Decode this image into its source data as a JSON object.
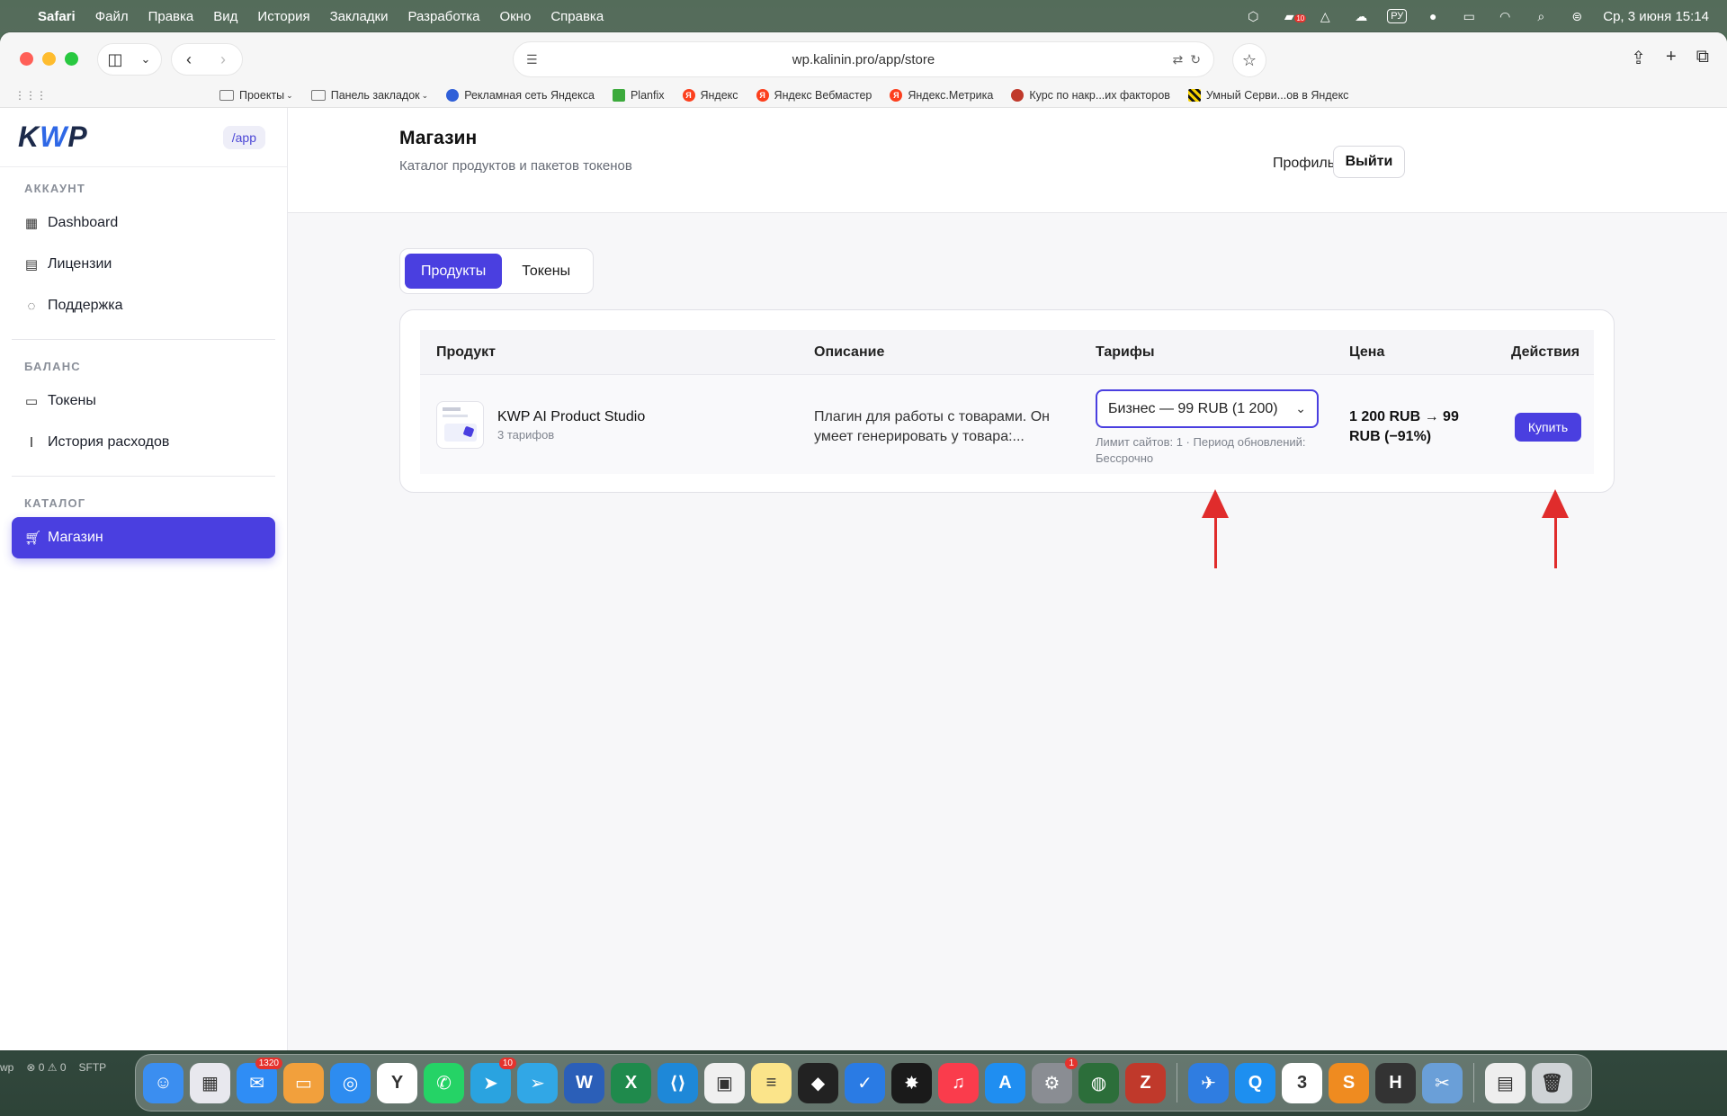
{
  "menubar": {
    "app_name": "Safari",
    "items": [
      "Файл",
      "Правка",
      "Вид",
      "История",
      "Закладки",
      "Разработка",
      "Окно",
      "Справка"
    ],
    "badge": "10",
    "lang": "РУ",
    "datetime": "Ср, 3 июня  15:14"
  },
  "browser": {
    "url": "wp.kalinin.pro/app/store",
    "bookmarks": [
      {
        "label": "Проекты",
        "icon": "folder-icon",
        "dropdown": true
      },
      {
        "label": "Панель закладок",
        "icon": "folder-icon",
        "dropdown": true
      },
      {
        "label": "Рекламная сеть Яндекса",
        "icon": "globe-icon",
        "color": "#f5c518"
      },
      {
        "label": "Planfix",
        "icon": "flag-icon",
        "color": "#3caa3c"
      },
      {
        "label": "Яндекс",
        "icon": "yandex-icon",
        "color": "#fc3f1d"
      },
      {
        "label": "Яндекс Вебмастер",
        "icon": "yandex-icon",
        "color": "#fc3f1d"
      },
      {
        "label": "Яндекс.Метрика",
        "icon": "yandex-icon",
        "color": "#fc3f1d"
      },
      {
        "label": "Курс по накр...их факторов",
        "icon": "seo-icon",
        "color": "#c0392b"
      },
      {
        "label": "Умный Серви...ов в Яндекс",
        "icon": "stripe-icon",
        "color": "#f5d000"
      }
    ]
  },
  "sidebar": {
    "logo": {
      "k": "K",
      "w": "W",
      "p": "P"
    },
    "app_chip": "/app",
    "sections": [
      {
        "title": "АККАУНТ",
        "items": [
          {
            "label": "Dashboard",
            "icon": "grid-icon"
          },
          {
            "label": "Лицензии",
            "icon": "license-icon"
          },
          {
            "label": "Поддержка",
            "icon": "chat-icon"
          }
        ]
      },
      {
        "title": "БАЛАНС",
        "items": [
          {
            "label": "Токены",
            "icon": "card-icon"
          },
          {
            "label": "История расходов",
            "icon": "history-icon"
          }
        ]
      },
      {
        "title": "КАТАЛОГ",
        "items": [
          {
            "label": "Магазин",
            "icon": "cart-icon",
            "active": true
          }
        ]
      }
    ]
  },
  "header": {
    "title": "Магазин",
    "subtitle": "Каталог продуктов и пакетов токенов",
    "profile": "Профиль",
    "logout": "Выйти"
  },
  "tabs": [
    {
      "label": "Продукты",
      "active": true
    },
    {
      "label": "Токены",
      "active": false
    }
  ],
  "table": {
    "columns": [
      "Продукт",
      "Описание",
      "Тарифы",
      "Цена",
      "Действия"
    ],
    "rows": [
      {
        "product_name": "KWP AI Product Studio",
        "product_sub": "3 тарифов",
        "description": "Плагин для работы с товарами. Он умеет генерировать у товара:...",
        "tariff_selected": "Бизнес — 99 RUB (1 200)",
        "tariff_note": "Лимит сайтов: 1 · Период обновлений: Бессрочно",
        "price": "1 200 RUB → 99 RUB (−91%)",
        "action": "Купить"
      }
    ]
  },
  "dock": {
    "status": [
      "wp",
      "⊗ 0 ⚠ 0",
      "SFTP"
    ],
    "apps": [
      {
        "name": "finder-icon",
        "color": "#3b8ef0",
        "glyph": "☺"
      },
      {
        "name": "launchpad-icon",
        "color": "#e8e8ee",
        "glyph": "▦"
      },
      {
        "name": "mail-icon",
        "color": "#2f8df5",
        "glyph": "✉",
        "badge": "1320"
      },
      {
        "name": "inbox-icon",
        "color": "#f2a03c",
        "glyph": "▭"
      },
      {
        "name": "safari-icon",
        "color": "#2d8cf0",
        "glyph": "◎"
      },
      {
        "name": "yandex-browser-icon",
        "color": "#ffffff",
        "glyph": "Y"
      },
      {
        "name": "whatsapp-icon",
        "color": "#25d366",
        "glyph": "✆"
      },
      {
        "name": "telegram-icon",
        "color": "#2aa3e0",
        "glyph": "➤",
        "badge": "10"
      },
      {
        "name": "telegram-x-icon",
        "color": "#31a7e6",
        "glyph": "➢"
      },
      {
        "name": "word-icon",
        "color": "#2b5fb8",
        "glyph": "W"
      },
      {
        "name": "excel-icon",
        "color": "#1f8a4c",
        "glyph": "X"
      },
      {
        "name": "vscode-icon",
        "color": "#1e88d8",
        "glyph": "⟨⟩"
      },
      {
        "name": "terminal-icon",
        "color": "#f0f0f0",
        "glyph": "▣"
      },
      {
        "name": "notes-icon",
        "color": "#fbe48a",
        "glyph": "≡"
      },
      {
        "name": "cube-app-icon",
        "color": "#222222",
        "glyph": "◆"
      },
      {
        "name": "tasks-icon",
        "color": "#2a7be4",
        "glyph": "✓"
      },
      {
        "name": "sun-app-icon",
        "color": "#1a1a1a",
        "glyph": "✸"
      },
      {
        "name": "music-icon",
        "color": "#fa3c4c",
        "glyph": "♫"
      },
      {
        "name": "app-store-icon",
        "color": "#1f8ef1",
        "glyph": "A"
      },
      {
        "name": "settings-icon",
        "color": "#8a8d93",
        "glyph": "⚙",
        "badge": "1"
      },
      {
        "name": "globe-app-icon",
        "color": "#2c6e3a",
        "glyph": "◍"
      },
      {
        "name": "filezilla-icon",
        "color": "#c0392b",
        "glyph": "Z"
      },
      {
        "name": "sep",
        "color": "",
        "glyph": ""
      },
      {
        "name": "bird-app-icon",
        "color": "#2f7de1",
        "glyph": "✈"
      },
      {
        "name": "search-app-icon",
        "color": "#1d8ff0",
        "glyph": "Q"
      },
      {
        "name": "calendar-icon",
        "color": "#ffffff",
        "glyph": "3"
      },
      {
        "name": "sublime-icon",
        "color": "#ef8b20",
        "glyph": "S"
      },
      {
        "name": "h-app-icon",
        "color": "#333333",
        "glyph": "H"
      },
      {
        "name": "preview-icon",
        "color": "#6a9fd8",
        "glyph": "✂"
      },
      {
        "name": "sep",
        "color": "",
        "glyph": ""
      },
      {
        "name": "document-icon",
        "color": "#eeeeee",
        "glyph": "▤"
      },
      {
        "name": "trash-icon",
        "color": "#cfd3d6",
        "glyph": "🗑"
      }
    ]
  }
}
